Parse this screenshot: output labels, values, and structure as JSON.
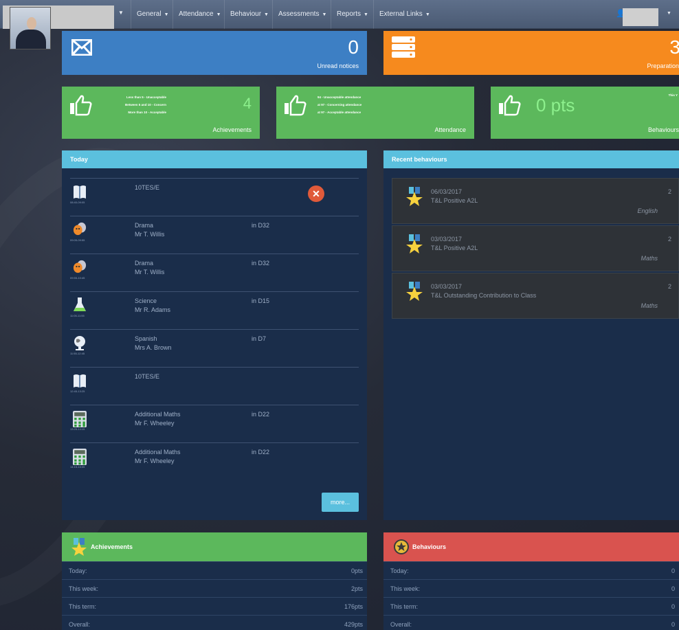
{
  "nav": {
    "items": [
      {
        "label": "General"
      },
      {
        "label": "Attendance"
      },
      {
        "label": "Behaviour"
      },
      {
        "label": "Assessments"
      },
      {
        "label": "Reports"
      },
      {
        "label": "External Links"
      }
    ]
  },
  "tiles": {
    "unread": {
      "value": "0",
      "label": "Unread notices"
    },
    "preparation": {
      "value": "3",
      "label": "Preparation"
    }
  },
  "green_tiles": {
    "achievements": {
      "legend": [
        "Less than 5 - Unacceptable",
        "Between 5 and 10 - Concern",
        "More than 10 - Acceptable"
      ],
      "value": "4",
      "label": "Achievements"
    },
    "attendance": {
      "legend": [
        "94 - Unacceptable attendance",
        "at 97 - Concerning attendance",
        "at 97 - Acceptable attendance"
      ],
      "value": "",
      "label": "Attendance"
    },
    "behaviours": {
      "value": "0 pts",
      "small": "This Y",
      "label": "Behaviours"
    }
  },
  "today": {
    "title": "Today",
    "rows": [
      {
        "icon": "book-icon",
        "time": "08:40-09:05",
        "subject": "10TES/E",
        "teacher": "",
        "room": "",
        "cancelled": true
      },
      {
        "icon": "drama-masks-icon",
        "time": "09:05-09:55",
        "subject": "Drama",
        "teacher": "Mr T. Willis",
        "room": "in D32"
      },
      {
        "icon": "drama-masks-icon",
        "time": "09:55-10:45",
        "subject": "Drama",
        "teacher": "Mr T. Willis",
        "room": "in D32"
      },
      {
        "icon": "flask-icon",
        "time": "11:05-11:55",
        "subject": "Science",
        "teacher": "Mr R. Adams",
        "room": "in D15"
      },
      {
        "icon": "globe-icon",
        "time": "11:55-12:45",
        "subject": "Spanish",
        "teacher": "Mrs A. Brown",
        "room": "in D7"
      },
      {
        "icon": "book-icon",
        "time": "12:45-13:25",
        "subject": "10TES/E",
        "teacher": "",
        "room": ""
      },
      {
        "icon": "calculator-icon",
        "time": "13:25-14:15",
        "subject": "Additional Maths",
        "teacher": "Mr F. Wheeley",
        "room": "in D22"
      },
      {
        "icon": "calculator-icon",
        "time": "14:15-15:05",
        "subject": "Additional Maths",
        "teacher": "Mr F. Wheeley",
        "room": "in D22"
      }
    ],
    "more_label": "more..."
  },
  "recent_behaviours": {
    "title": "Recent behaviours",
    "items": [
      {
        "date": "06/03/2017",
        "desc": "T&L Positive A2L",
        "points": "2",
        "subject": "English"
      },
      {
        "date": "03/03/2017",
        "desc": "T&L Positive A2L",
        "points": "2",
        "subject": "Maths"
      },
      {
        "date": "03/03/2017",
        "desc": "T&L Outstanding Contribution to Class",
        "points": "2",
        "subject": "Maths"
      }
    ]
  },
  "achievements_panel": {
    "title": "Achievements",
    "rows": [
      {
        "label": "Today:",
        "value": "0pts"
      },
      {
        "label": "This week:",
        "value": "2pts"
      },
      {
        "label": "This term:",
        "value": "176pts"
      },
      {
        "label": "Overall:",
        "value": "429pts"
      }
    ]
  },
  "behaviours_panel": {
    "title": "Behaviours",
    "rows": [
      {
        "label": "Today:",
        "value": "0"
      },
      {
        "label": "This week:",
        "value": "0"
      },
      {
        "label": "This term:",
        "value": "0"
      },
      {
        "label": "Overall:",
        "value": "0"
      }
    ]
  },
  "colors": {
    "blue_tile": "#3d7fc4",
    "orange_tile": "#f68a1e",
    "green_tile": "#5cb85c",
    "panel_head": "#5bc0de",
    "red_head": "#d9534f"
  }
}
